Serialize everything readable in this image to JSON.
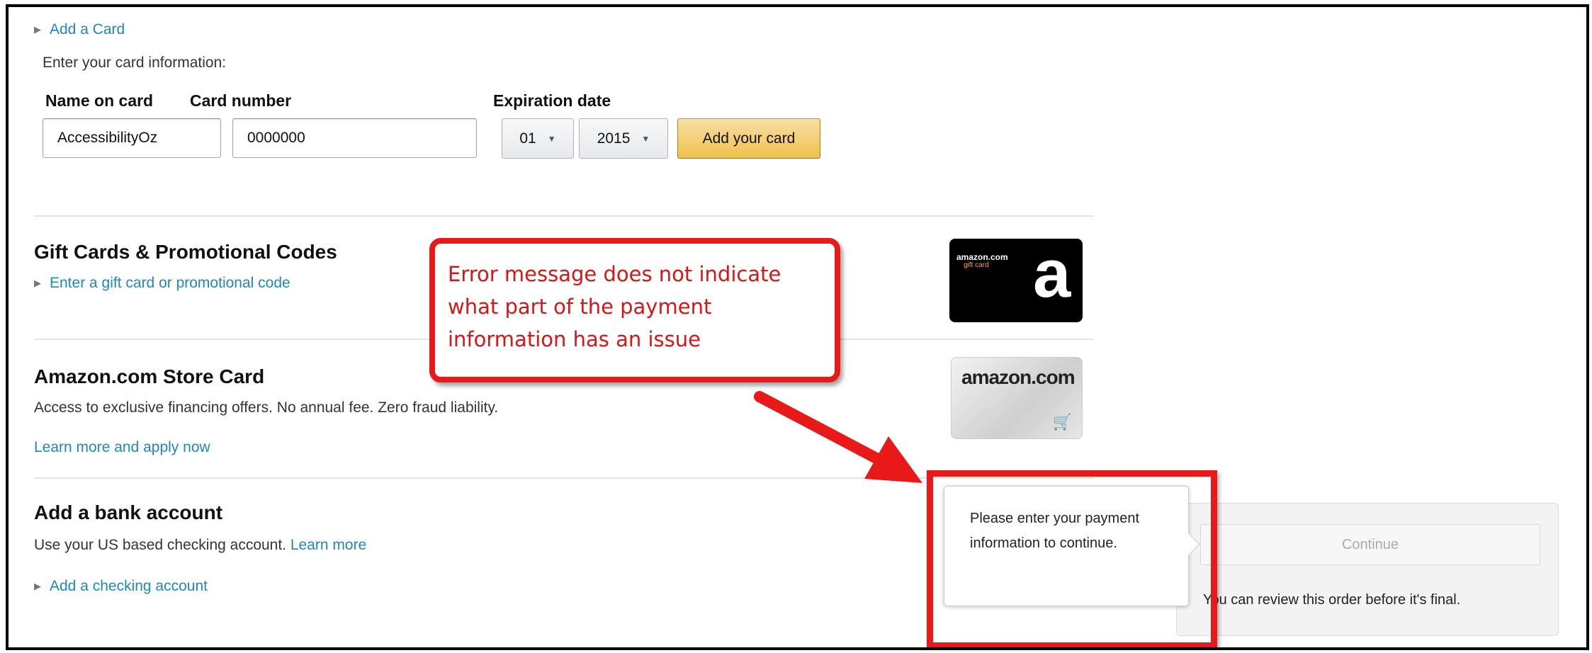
{
  "add_card": {
    "toggle_label": "Add a Card",
    "instruction": "Enter your card information:",
    "name_label": "Name on card",
    "name_value": "AccessibilityOz",
    "number_label": "Card number",
    "number_value": "0000000",
    "expiration_label": "Expiration date",
    "month_value": "01",
    "year_value": "2015",
    "submit_label": "Add your card"
  },
  "gift_cards": {
    "title": "Gift Cards & Promotional Codes",
    "link": "Enter a gift card or promotional code",
    "image_logo": "amazon.com",
    "image_sub": "gift card",
    "image_letter": "a"
  },
  "store_card": {
    "title": "Amazon.com Store Card",
    "description": "Access to exclusive financing offers. No annual fee. Zero fraud liability.",
    "link": "Learn more and apply now",
    "image_logo": "amazon.com"
  },
  "bank_account": {
    "title": "Add a bank account",
    "description": "Use your US based checking account.",
    "learn_more": "Learn more",
    "add_link": "Add a checking account"
  },
  "tooltip": {
    "message": "Please enter your payment information to continue."
  },
  "continue_panel": {
    "button_label": "Continue",
    "review_text": "You can review this order before it's final."
  },
  "annotation": {
    "callout_text": "Error message does not indicate what part of the payment information has an issue",
    "color": "#e81919"
  },
  "icons": {
    "expand": "triangle-right-icon",
    "dropdown": "caret-down-icon",
    "cart": "shopping-cart-icon"
  }
}
